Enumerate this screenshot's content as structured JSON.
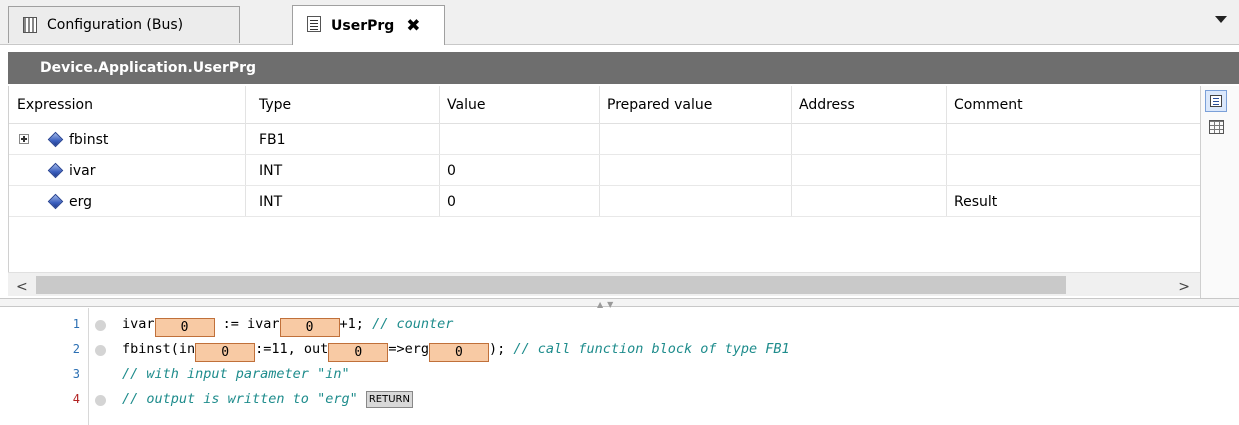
{
  "tabs": [
    {
      "label": "Configuration (Bus)",
      "icon": "configuration-icon",
      "active": false
    },
    {
      "label": "UserPrg",
      "icon": "document-icon",
      "active": true,
      "close": "✖"
    }
  ],
  "header": {
    "title": "Device.Application.UserPrg"
  },
  "watch": {
    "columns": [
      "Expression",
      "Type",
      "Value",
      "Prepared value",
      "Address",
      "Comment"
    ],
    "rows": [
      {
        "expression": "fbinst",
        "type": "FB1",
        "value": "",
        "prepared": "",
        "address": "",
        "comment": "",
        "expandable": true
      },
      {
        "expression": "ivar",
        "type": "INT",
        "value": "0",
        "prepared": "",
        "address": "",
        "comment": ""
      },
      {
        "expression": "erg",
        "type": "INT",
        "value": "0",
        "prepared": "",
        "address": "",
        "comment": "Result"
      }
    ]
  },
  "scroll": {
    "left": "<",
    "right": ">"
  },
  "code": {
    "lines": [
      {
        "num": "1",
        "parts": {
          "a": "ivar",
          "b": "0",
          "c": " := ivar",
          "d": "0",
          "e": "+1; ",
          "f": "// counter"
        }
      },
      {
        "num": "2",
        "parts": {
          "a": "fbinst(in",
          "b": "0",
          "c": ":=11, out",
          "d": "0",
          "e": "=>erg",
          "g": "0",
          "h": "); ",
          "f": "// call function block of type FB1"
        }
      },
      {
        "num": "3",
        "parts": {
          "f": "// with input parameter \"in\""
        }
      },
      {
        "num": "4",
        "parts": {
          "f": "// output is written to \"erg\"",
          "r": "RETURN"
        }
      }
    ]
  },
  "colors": {
    "header_band": "#6e6e6e",
    "inline_value_bg": "#f8caa4",
    "comment": "#1e8c8c"
  }
}
